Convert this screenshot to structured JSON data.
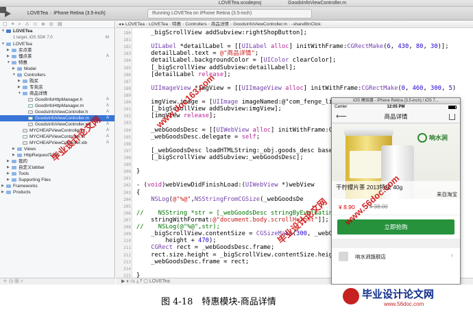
{
  "window": {
    "title": "LOVETea.xcodeproj",
    "file_title": "GoodsInfoViewController.m"
  },
  "toolbar": {
    "scheme": "LOVETea",
    "device": "iPhone Retina (3.5-inch)",
    "status": "Running LOVETea on iPhone Retina (3.5-inch)"
  },
  "navigator": {
    "project_name": "LOVETea",
    "project_sub": "1 target, iOS SDK 7.0",
    "items": [
      {
        "label": "LOVETea",
        "indent": 1,
        "kind": "folder",
        "status": "",
        "expanded": true
      },
      {
        "label": "买点茶",
        "indent": 2,
        "kind": "folder",
        "status": "",
        "expanded": false
      },
      {
        "label": "懂点茶",
        "indent": 2,
        "kind": "folder",
        "status": "A",
        "expanded": false
      },
      {
        "label": "特惠",
        "indent": 2,
        "kind": "folder",
        "status": "",
        "expanded": true
      },
      {
        "label": "Model",
        "indent": 3,
        "kind": "folder",
        "status": "",
        "expanded": false
      },
      {
        "label": "Controllers",
        "indent": 3,
        "kind": "folder",
        "status": "",
        "expanded": true
      },
      {
        "label": "购买",
        "indent": 4,
        "kind": "folder",
        "status": "",
        "expanded": false
      },
      {
        "label": "专卖店",
        "indent": 4,
        "kind": "folder",
        "status": "",
        "expanded": false
      },
      {
        "label": "商品详情",
        "indent": 4,
        "kind": "folder",
        "status": "",
        "expanded": true
      },
      {
        "label": "GoodInfoHttpManager.h",
        "indent": 5,
        "kind": "h",
        "status": "A"
      },
      {
        "label": "GoodInfoHttpManager.m",
        "indent": 5,
        "kind": "m",
        "status": "A"
      },
      {
        "label": "GoodsInfoViewController.h",
        "indent": 5,
        "kind": "h",
        "status": "A"
      },
      {
        "label": "GoodsInfoViewController.m",
        "indent": 5,
        "kind": "m",
        "status": "A",
        "selected": true
      },
      {
        "label": "GoodsInfoViewController.xib",
        "indent": 5,
        "kind": "h",
        "status": "A"
      },
      {
        "label": "MYCHEAPViewController.h",
        "indent": 4,
        "kind": "h",
        "status": "A"
      },
      {
        "label": "MYCHEAPViewController.m",
        "indent": 4,
        "kind": "m",
        "status": "A"
      },
      {
        "label": "MYCHEAPViewController.xib",
        "indent": 4,
        "kind": "h",
        "status": "A"
      },
      {
        "label": "Views",
        "indent": 3,
        "kind": "folder",
        "status": "",
        "expanded": false
      },
      {
        "label": "HttpRequestTools",
        "indent": 3,
        "kind": "folder",
        "status": "",
        "expanded": false
      },
      {
        "label": "我的",
        "indent": 2,
        "kind": "folder",
        "status": "",
        "expanded": false
      },
      {
        "label": "自定义tabbar",
        "indent": 2,
        "kind": "folder",
        "status": "",
        "expanded": false
      },
      {
        "label": "Tools",
        "indent": 2,
        "kind": "folder",
        "status": "",
        "expanded": false
      },
      {
        "label": "Supporting Files",
        "indent": 2,
        "kind": "folder",
        "status": "",
        "expanded": false
      },
      {
        "label": "Frameworks",
        "indent": 1,
        "kind": "folder",
        "status": "",
        "expanded": false
      },
      {
        "label": "Products",
        "indent": 1,
        "kind": "folder",
        "status": "",
        "expanded": false
      }
    ]
  },
  "editor": {
    "jumpbar": [
      "LOVETea",
      "LOVETea",
      "特惠",
      "Controllers",
      "商品详情",
      "GoodsInfoViewController.m",
      "-shareBtnClick:"
    ],
    "code_lines": [
      "    _bigScrollView addSubview:rightShopButton];",
      "",
      "    UILabel *detailLabel = [[UILabel alloc] initWithFrame:CGRectMake(6, 430, 80, 30)];",
      "    detailLabel.text = @\"商品详情\";",
      "    detailLabel.backgroundColor = [UIColor clearColor];",
      "    [_bigScrollView addSubview:detailLabel];",
      "    [detailLabel release];",
      "",
      "    UIImageView *imgView = [[UIImageView alloc] initWithFrame:CGRectMake(0, 460, 300, 5)",
      "",
      "    imgView.image = [UIImage imageNamed:@\"com_fenge_li",
      "    [_bigScrollView addSubview:imgView];",
      "    [imgView release];",
      "",
      "    _webGoodsDesc = [[UIWebView alloc] initWithFrame:C",
      "    _webGoodsDesc.delegate = self;",
      "",
      "    [_webGoodsDesc loadHTMLString:_obj.goods_desc base",
      "    [_bigScrollView addSubview:_webGoodsDesc];",
      "",
      "}",
      "",
      "- (void)webViewDidFinishLoad:(UIWebView *)webView",
      "{",
      "    NSLog(@\"%@\",NSStringFromCGSize(_webGoodsDe",
      "",
      "//    NSString *str = [_webGoodsDesc stringByEvaluating",
      "    stringWithFormat:@\"document.body.scrollHeight\"]];",
      "//    NSLog(@\"%@\",str);",
      "    _bigScrollView.contentSize = CGSizeMake(300, _webG",
      "        height + 470);",
      "    CGRect rect = _webGoodsDesc.frame;",
      "    rect.size.height = _bigScrollView.contentSize.heig",
      "    _webGoodsDesc.frame = rect;",
      "",
      "}"
    ],
    "line_start": 180,
    "debug_target": "LOVETea"
  },
  "simulator": {
    "window_title": "iOS 模拟器 - iPhone Retina (3.5-inch) / iOS 7...",
    "carrier": "Carrier",
    "time": "12:05 PM",
    "nav_title": "商品详情",
    "brand_name": "响水涧",
    "product_name": "干柠檬片茶 2013特级 40g",
    "source": "来自淘宝",
    "price_now": "¥ 8.90",
    "price_old": "¥ 38.00",
    "buy_label": "立即抢购",
    "shop_name": "响水涧旗舰店"
  },
  "figure": {
    "caption": "图 4-18　特惠模块-商品详情",
    "brand_title": "毕业设计论文网",
    "brand_url": "www.56doc.com"
  },
  "watermarks": [
    "毕业设计论文网",
    "www.56doc.com",
    "www.doc163.com",
    "毕业设计论文网"
  ],
  "colors": {
    "accent_select": "#3875d7",
    "buy_button": "#26923c",
    "price": "#d40000",
    "watermark": "#cc0000"
  }
}
